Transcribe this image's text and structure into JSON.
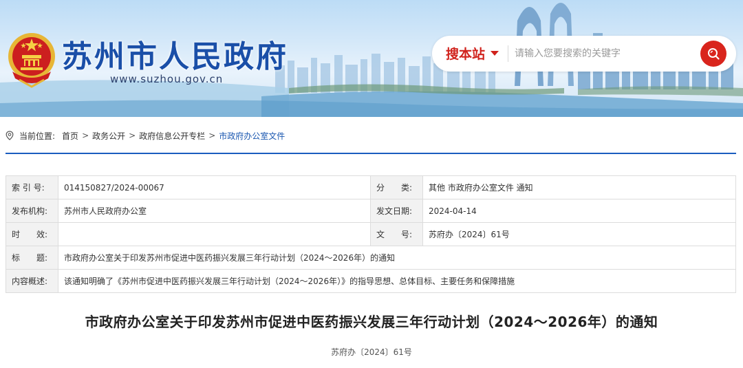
{
  "header": {
    "site_name": "苏州市人民政府",
    "site_url": "www.suzhou.gov.cn",
    "search": {
      "scope_label": "搜本站",
      "placeholder": "请输入您要搜索的关键字"
    }
  },
  "breadcrumb": {
    "prefix": "当前位置:",
    "items": [
      "首页",
      "政务公开",
      "政府信息公开专栏",
      "市政府办公室文件"
    ]
  },
  "meta": {
    "index_no_label": "索 引 号:",
    "index_no": "014150827/2024-00067",
    "category_label": "分　　类:",
    "category": "其他 市政府办公室文件 通知",
    "issuer_label": "发布机构:",
    "issuer": "苏州市人民政府办公室",
    "date_label": "发文日期:",
    "date": "2024-04-14",
    "validity_label": "时　　效:",
    "validity": "",
    "doc_no_label": "文　　号:",
    "doc_no": "苏府办〔2024〕61号",
    "title_label": "标　　题:",
    "title": "市政府办公室关于印发苏州市促进中医药振兴发展三年行动计划（2024～2026年）的通知",
    "summary_label": "内容概述:",
    "summary": "该通知明确了《苏州市促进中医药振兴发展三年行动计划（2024～2026年）》的指导思想、总体目标、主要任务和保障措施"
  },
  "document": {
    "title": "市政府办公室关于印发苏州市促进中医药振兴发展三年行动计划（2024～2026年）的通知",
    "number": "苏府办〔2024〕61号"
  },
  "colors": {
    "brand_blue": "#1a4fa8",
    "accent_red": "#d9251d",
    "link_blue": "#1a57b0",
    "rule_blue": "#1a5dbf"
  },
  "icons": [
    "national-emblem-icon",
    "search-icon",
    "location-pin-icon",
    "dropdown-caret-icon"
  ]
}
